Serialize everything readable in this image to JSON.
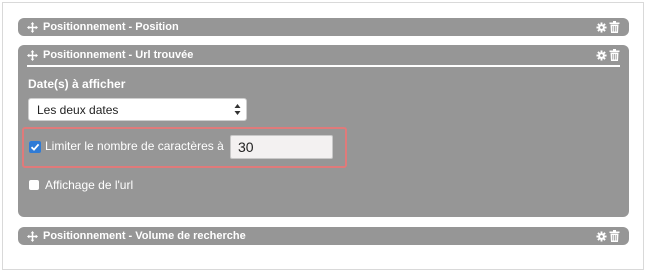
{
  "panels": [
    {
      "title": "Positionnement - Position"
    },
    {
      "title": "Positionnement - Url trouvée"
    },
    {
      "title": "Positionnement - Volume de recherche"
    }
  ],
  "open_panel": {
    "section_label": "Date(s) à afficher",
    "date_select": {
      "selected": "Les deux dates"
    },
    "limit_option": {
      "label": "Limiter le nombre de caractères à",
      "checked": true,
      "value": "30"
    },
    "show_url_option": {
      "label": "Affichage de l'url",
      "checked": false
    }
  },
  "icons": {
    "move": "move-arrows-icon",
    "settings": "gear-icon",
    "delete": "trash-icon"
  },
  "colors": {
    "panel_bg": "#969696",
    "highlight_border": "#e07a7a",
    "checkbox_accent": "#2f7bd6"
  }
}
